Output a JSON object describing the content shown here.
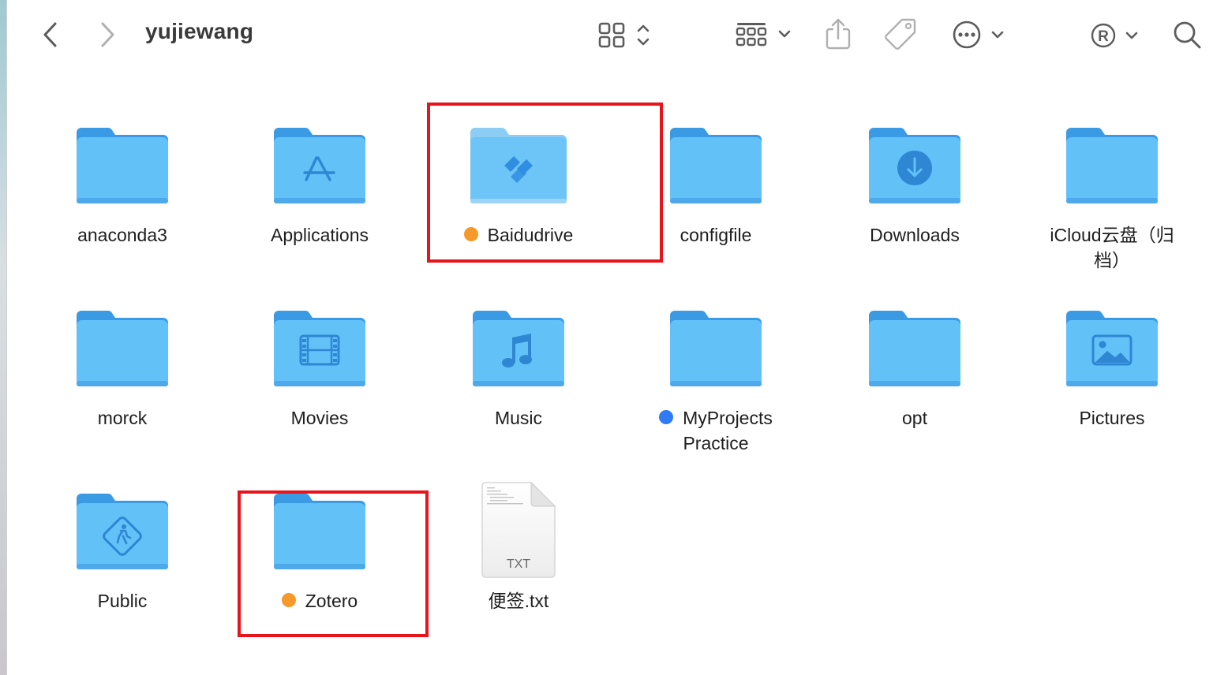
{
  "window": {
    "title": "yujiewang"
  },
  "toolbar": {
    "back_icon": "chevron-left-icon",
    "forward_icon": "chevron-right-icon",
    "view_icon": "icon-grid-view-icon",
    "group_icon": "group-by-icon",
    "share_icon": "share-icon",
    "tag_icon": "tag-icon",
    "more_icon": "ellipsis-circle-icon",
    "registered_icon": "registered-icon",
    "search_icon": "search-icon"
  },
  "colors": {
    "folder_light": "#62c2f8",
    "folder_dark": "#3b9ae4",
    "tag_orange": "#f7982b",
    "tag_blue": "#2f7bf5",
    "highlight": "#e8141c"
  },
  "items": [
    {
      "name": "anaconda3",
      "icon": "folder-icon"
    },
    {
      "name": "Applications",
      "icon": "applications-folder-icon"
    },
    {
      "name": "Baidudrive",
      "icon": "baidu-drive-folder-icon",
      "tag": "orange",
      "highlighted": true
    },
    {
      "name": "configfile",
      "icon": "folder-icon"
    },
    {
      "name": "Downloads",
      "icon": "downloads-folder-icon"
    },
    {
      "name": "iCloud云盘（归",
      "name2": "档）",
      "icon": "folder-icon"
    },
    {
      "name": "morck",
      "icon": "folder-icon"
    },
    {
      "name": "Movies",
      "icon": "movies-folder-icon"
    },
    {
      "name": "Music",
      "icon": "music-folder-icon"
    },
    {
      "name": "MyProjects",
      "name2": "Practice",
      "icon": "folder-icon",
      "tag": "blue"
    },
    {
      "name": "opt",
      "icon": "folder-icon"
    },
    {
      "name": "Pictures",
      "icon": "pictures-folder-icon"
    },
    {
      "name": "Public",
      "icon": "public-folder-icon"
    },
    {
      "name": "Zotero",
      "icon": "folder-icon",
      "tag": "orange",
      "highlighted": true
    },
    {
      "name": "便签.txt",
      "icon": "text-file-icon",
      "file_badge": "TXT"
    }
  ]
}
